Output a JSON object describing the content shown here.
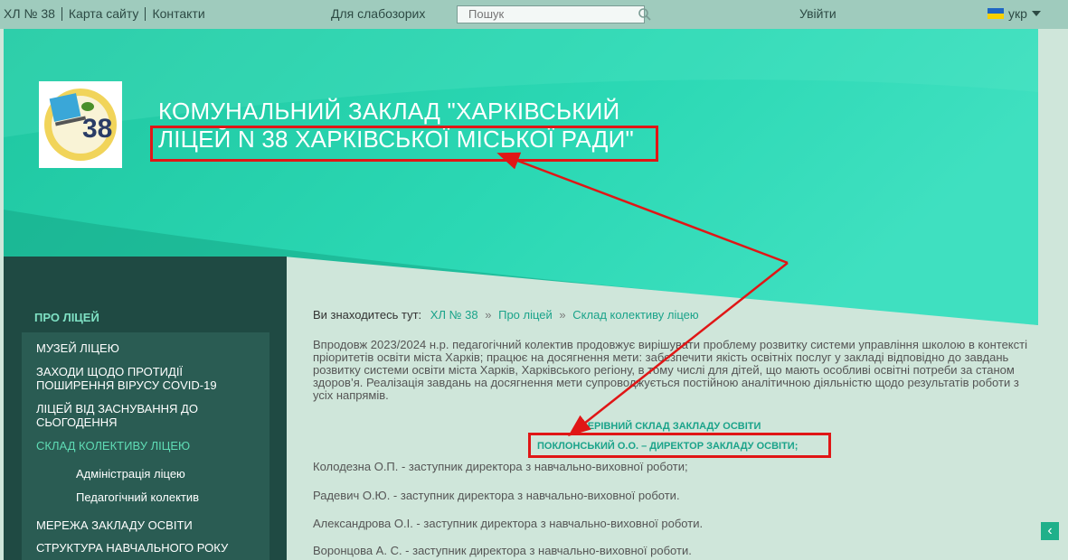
{
  "topbar": {
    "links": [
      "ХЛ № 38",
      "Карта сайту",
      "Контакти"
    ],
    "visually_impaired": "Для слабозорих",
    "search_placeholder": "Пошук",
    "login": "Увійти",
    "language": "укр"
  },
  "header": {
    "title_line1": "КОМУНАЛЬНИЙ ЗАКЛАД \"ХАРКІВСЬКИЙ",
    "title_line2": "ЛІЦЕЙ N 38 ХАРКІВСЬКОЇ МІСЬКОЇ РАДИ\"",
    "logo_number": "38"
  },
  "sidebar": {
    "heading": "ПРО ЛІЦЕЙ",
    "items": [
      "МУЗЕЙ ЛІЦЕЮ",
      "ЗАХОДИ ЩОДО ПРОТИДІЇ ПОШИРЕННЯ ВІРУСУ COVID-19",
      "ЛІЦЕЙ ВІД ЗАСНУВАННЯ ДО СЬОГОДЕННЯ",
      "СКЛАД КОЛЕКТИВУ ЛІЦЕЮ",
      "МЕРЕЖА ЗАКЛАДУ ОСВІТИ",
      "СТРУКТУРА НАВЧАЛЬНОГО РОКУ"
    ],
    "subitems": [
      "Адміністрація ліцею",
      "Педагогічний колектив"
    ]
  },
  "breadcrumb": {
    "prefix": "Ви знаходитесь тут:",
    "items": [
      "ХЛ № 38",
      "Про ліцей",
      "Склад колективу ліцею"
    ],
    "separator": "»"
  },
  "content": {
    "intro": "Впродовж 2023/2024 н.р. педагогічний колектив продовжує вирішувати проблему розвитку системи управління школою в контексті пріоритетів освіти міста Харків; працює на досягнення мети: забезпечити якість освітніх послуг у закладі відповідно до завдань розвитку системи освіти міста Харків, Харківського регіону, в тому числі для дітей, що мають особливі освітні потреби за станом здоров’я. Реалізація завдань на досягнення мети супроводжується постійною аналітичною діяльністю щодо результатів роботи з усіх напрямів.",
    "leadership_title": "КЕРІВНИЙ СКЛАД ЗАКЛАДУ ОСВІТИ",
    "director": "ПОКЛОНСЬКИЙ О.О. – ДИРЕКТОР ЗАКЛАДУ ОСВІТИ;",
    "staff": [
      "Колодезна О.П. - заступник директора з навчально-виховної роботи;",
      "Радевич О.Ю. - заступник директора з навчально-виховної роботи.",
      "Александрова О.І. - заступник директора з навчально-виховної роботи.",
      "Воронцова А. С. - заступник директора з навчально-виховної роботи."
    ]
  },
  "colors": {
    "accent": "#1aa38a",
    "annotation": "#e01616",
    "sidebar": "#1f4a43"
  }
}
